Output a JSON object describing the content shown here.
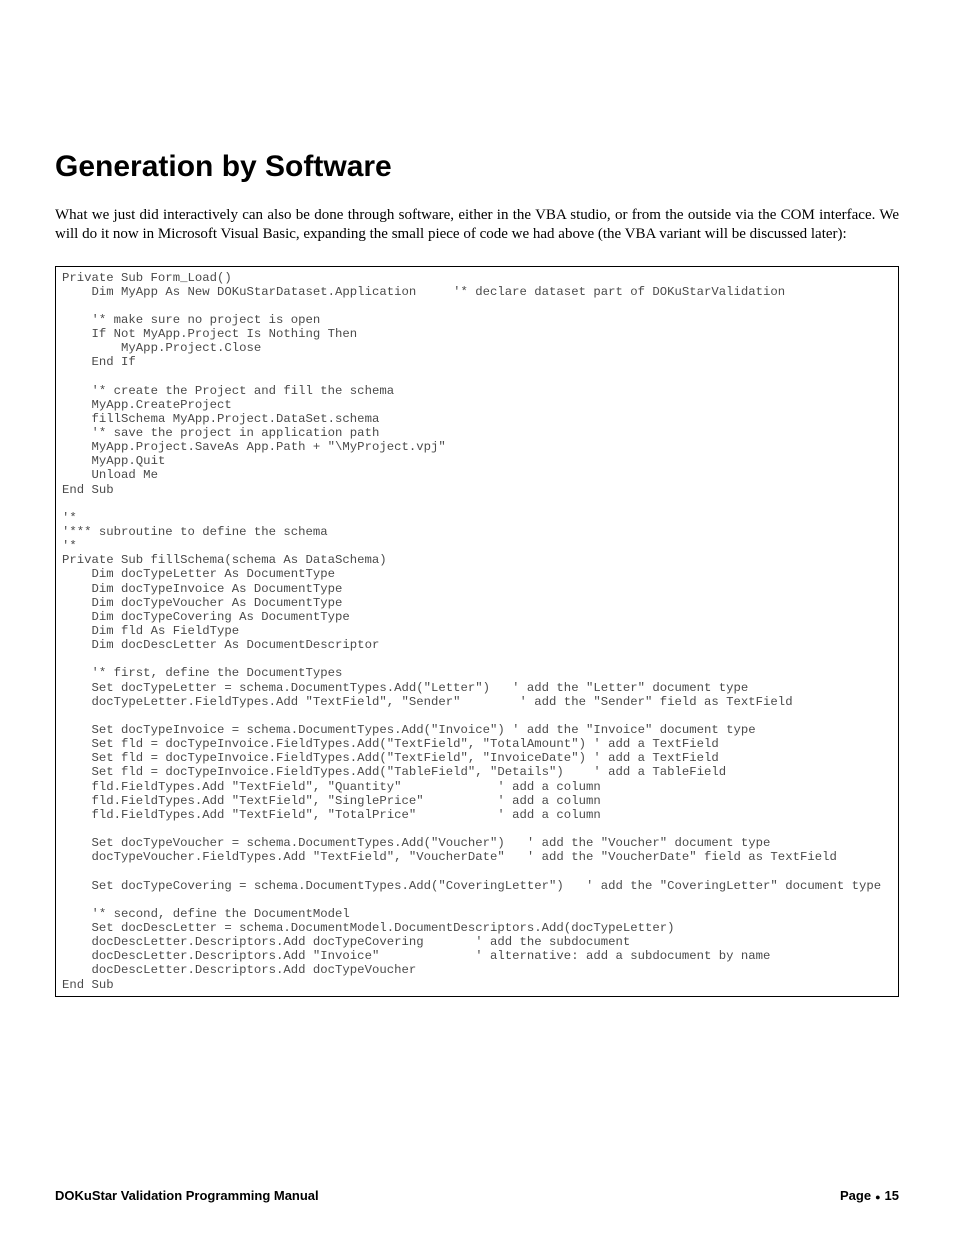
{
  "heading": "Generation by Software",
  "intro": "What we just did interactively can also be done through software, either in the VBA studio, or from the outside via the COM interface. We will do it now in Microsoft Visual Basic, expanding the small piece of code we had above (the VBA variant will be discussed later):",
  "code": "Private Sub Form_Load()\n    Dim MyApp As New DOKuStarDataset.Application     '* declare dataset part of DOKuStarValidation\n\n    '* make sure no project is open\n    If Not MyApp.Project Is Nothing Then\n        MyApp.Project.Close\n    End If\n\n    '* create the Project and fill the schema\n    MyApp.CreateProject\n    fillSchema MyApp.Project.DataSet.schema\n    '* save the project in application path\n    MyApp.Project.SaveAs App.Path + \"\\MyProject.vpj\"\n    MyApp.Quit\n    Unload Me\nEnd Sub\n\n'*\n'*** subroutine to define the schema\n'*\nPrivate Sub fillSchema(schema As DataSchema)\n    Dim docTypeLetter As DocumentType\n    Dim docTypeInvoice As DocumentType\n    Dim docTypeVoucher As DocumentType\n    Dim docTypeCovering As DocumentType\n    Dim fld As FieldType\n    Dim docDescLetter As DocumentDescriptor\n\n    '* first, define the DocumentTypes\n    Set docTypeLetter = schema.DocumentTypes.Add(\"Letter\")   ' add the \"Letter\" document type\n    docTypeLetter.FieldTypes.Add \"TextField\", \"Sender\"        ' add the \"Sender\" field as TextField\n\n    Set docTypeInvoice = schema.DocumentTypes.Add(\"Invoice\") ' add the \"Invoice\" document type\n    Set fld = docTypeInvoice.FieldTypes.Add(\"TextField\", \"TotalAmount\") ' add a TextField\n    Set fld = docTypeInvoice.FieldTypes.Add(\"TextField\", \"InvoiceDate\") ' add a TextField\n    Set fld = docTypeInvoice.FieldTypes.Add(\"TableField\", \"Details\")    ' add a TableField\n    fld.FieldTypes.Add \"TextField\", \"Quantity\"             ' add a column\n    fld.FieldTypes.Add \"TextField\", \"SinglePrice\"          ' add a column\n    fld.FieldTypes.Add \"TextField\", \"TotalPrice\"           ' add a column\n\n    Set docTypeVoucher = schema.DocumentTypes.Add(\"Voucher\")   ' add the \"Voucher\" document type\n    docTypeVoucher.FieldTypes.Add \"TextField\", \"VoucherDate\"   ' add the \"VoucherDate\" field as TextField\n\n    Set docTypeCovering = schema.DocumentTypes.Add(\"CoveringLetter\")   ' add the \"CoveringLetter\" document type\n\n    '* second, define the DocumentModel\n    Set docDescLetter = schema.DocumentModel.DocumentDescriptors.Add(docTypeLetter)\n    docDescLetter.Descriptors.Add docTypeCovering       ' add the subdocument\n    docDescLetter.Descriptors.Add \"Invoice\"             ' alternative: add a subdocument by name\n    docDescLetter.Descriptors.Add docTypeVoucher\nEnd Sub",
  "footer": {
    "left": "DOKuStar Validation Programming Manual",
    "right_label": "Page",
    "right_num": "15"
  }
}
